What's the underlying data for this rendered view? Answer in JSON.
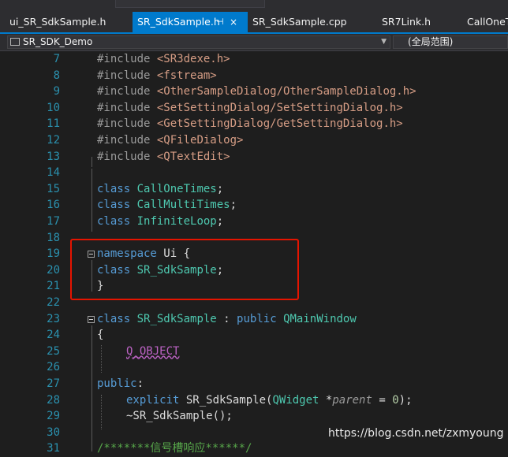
{
  "topbar": {
    "left_faded": "",
    "right_faded": "",
    "search_placeholder": ""
  },
  "tabs": [
    {
      "label": "ui_SR_SdkSample.h",
      "active": false
    },
    {
      "label": "SR_SdkSample.h",
      "active": true,
      "pin_glyph": "⊣",
      "close_glyph": "×"
    },
    {
      "label": "SR_SdkSample.cpp",
      "active": false
    },
    {
      "label": "SR7Link.h",
      "active": false
    },
    {
      "label": "CallOneT",
      "active": false
    }
  ],
  "navbar": {
    "project": "SR_SDK_Demo",
    "scope": "(全局范围)"
  },
  "editor": {
    "lines": [
      {
        "n": "7",
        "kw": "#include",
        "arg": "<SR3dexe.h>"
      },
      {
        "n": "8",
        "kw": "#include",
        "arg": "<fstream>"
      },
      {
        "n": "9",
        "kw": "#include",
        "arg": "<OtherSampleDialog/OtherSampleDialog.h>"
      },
      {
        "n": "10",
        "kw": "#include",
        "arg": "<SetSettingDialog/SetSettingDialog.h>"
      },
      {
        "n": "11",
        "kw": "#include",
        "arg": "<GetSettingDialog/GetSettingDialog.h>"
      },
      {
        "n": "12",
        "kw": "#include",
        "arg": "<QFileDialog>"
      },
      {
        "n": "13",
        "kw": "#include",
        "arg": "<QTextEdit>"
      },
      {
        "n": "14"
      },
      {
        "n": "15",
        "kw": "class",
        "name": "CallOneTimes",
        "end": ";"
      },
      {
        "n": "16",
        "kw": "class",
        "name": "CallMultiTimes",
        "end": ";"
      },
      {
        "n": "17",
        "kw": "class",
        "name": "InfiniteLoop",
        "end": ";"
      },
      {
        "n": "18"
      },
      {
        "n": "19",
        "kw": "namespace",
        "name": "Ui",
        "end": " {"
      },
      {
        "n": "20",
        "kw": "class",
        "name": "SR_SdkSample",
        "end": ";"
      },
      {
        "n": "21",
        "text": "}"
      },
      {
        "n": "22"
      },
      {
        "n": "23",
        "kw": "class",
        "name": "SR_SdkSample",
        "colon": " : ",
        "kw2": "public",
        "base": "QMainWindow"
      },
      {
        "n": "24",
        "text": "{"
      },
      {
        "n": "25",
        "macro": "Q_OBJECT"
      },
      {
        "n": "26"
      },
      {
        "n": "27",
        "kw": "public",
        "end": ":"
      },
      {
        "n": "28",
        "kw": "explicit",
        "name": "SR_SdkSample",
        "open": "(",
        "type": "QWidget",
        "rest": " *",
        "param": "parent",
        "eq": " = ",
        "num": "0",
        "close": ");"
      },
      {
        "n": "29",
        "text": "~SR_SdkSample();"
      },
      {
        "n": "30"
      },
      {
        "n": "31",
        "comment": "/*******信号槽响应******/"
      }
    ]
  },
  "watermark": "https://blog.csdn.net/zxmyoung"
}
